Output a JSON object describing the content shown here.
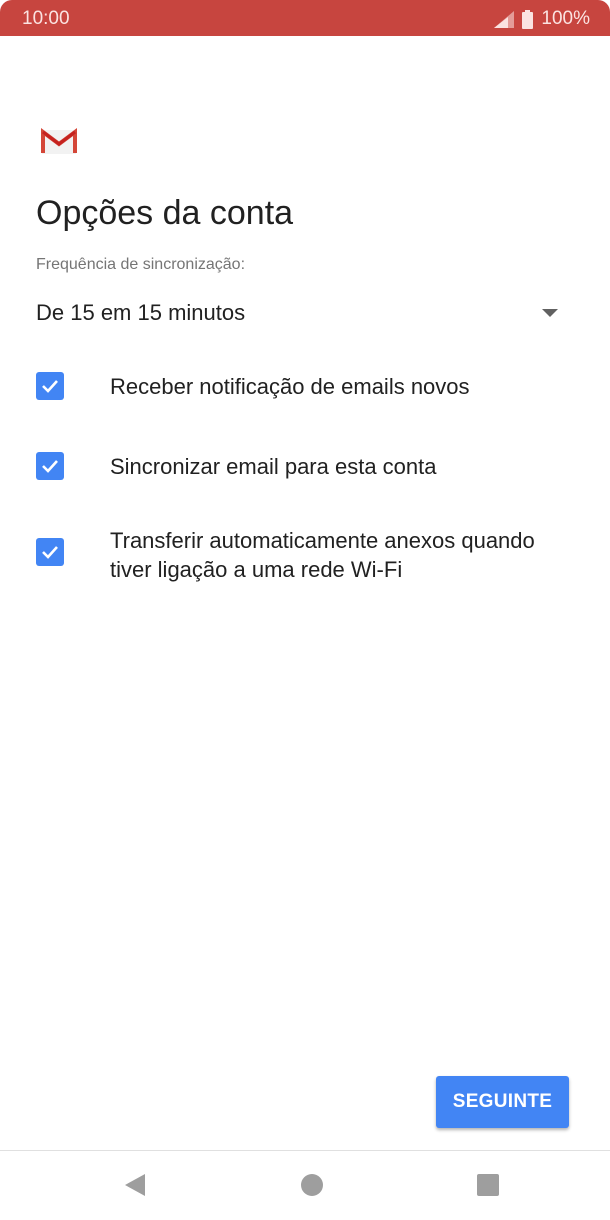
{
  "status_bar": {
    "time": "10:00",
    "battery": "100%",
    "icons": [
      "signal-icon",
      "battery-icon"
    ]
  },
  "app": {
    "logo": "gmail-logo-icon"
  },
  "page": {
    "title": "Opções da conta",
    "sync_label": "Frequência de sincronização:",
    "sync_value": "De 15 em 15 minutos"
  },
  "options": [
    {
      "label": "Receber notificação de emails novos",
      "checked": true
    },
    {
      "label": "Sincronizar email para esta conta",
      "checked": true
    },
    {
      "label": "Transferir automaticamente anexos quando tiver ligação a uma rede Wi-Fi",
      "checked": true
    }
  ],
  "actions": {
    "next_label": "SEGUINTE"
  },
  "nav": {
    "icons": [
      "back-icon",
      "home-icon",
      "recents-icon"
    ]
  },
  "colors": {
    "status_bar": "#c7453f",
    "accent": "#4285f4",
    "text": "#212121",
    "muted": "#757575"
  }
}
